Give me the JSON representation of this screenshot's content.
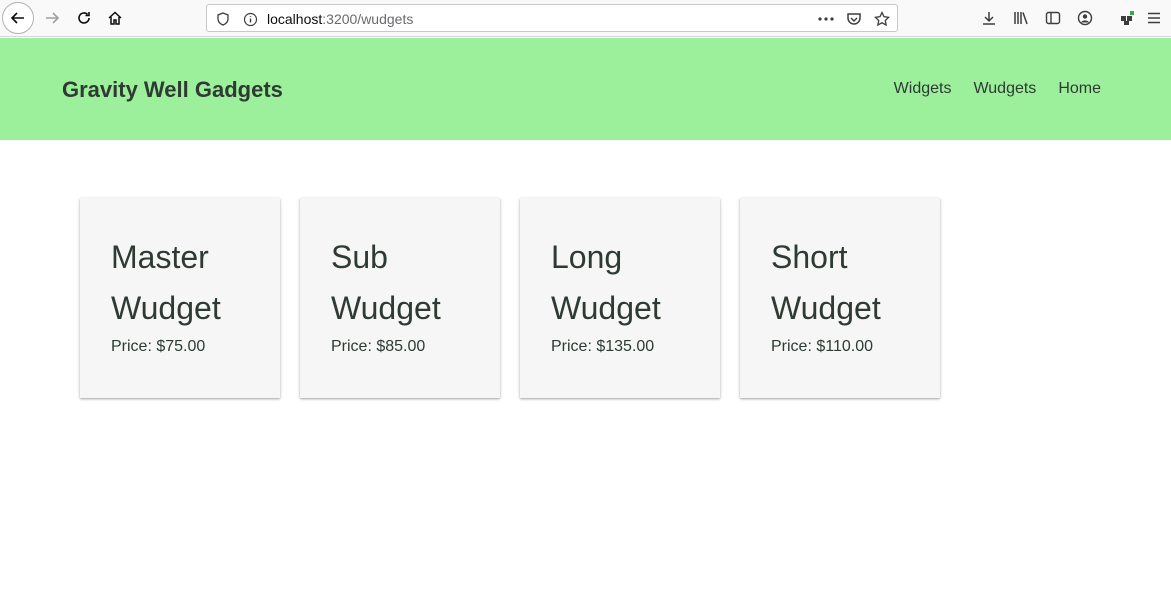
{
  "browser": {
    "url_host": "localhost",
    "url_path": ":3200/wudgets"
  },
  "header": {
    "brand": "Gravity Well Gadgets",
    "nav": [
      {
        "label": "Widgets"
      },
      {
        "label": "Wudgets"
      },
      {
        "label": "Home"
      }
    ],
    "background_color": "#9cf09c"
  },
  "cards": [
    {
      "title_line1": "Master",
      "title_line2": "Wudget",
      "price": "Price: $75.00"
    },
    {
      "title_line1": "Sub",
      "title_line2": "Wudget",
      "price": "Price: $85.00"
    },
    {
      "title_line1": "Long",
      "title_line2": "Wudget",
      "price": "Price: $135.00"
    },
    {
      "title_line1": "Short",
      "title_line2": "Wudget",
      "price": "Price: $110.00"
    }
  ]
}
